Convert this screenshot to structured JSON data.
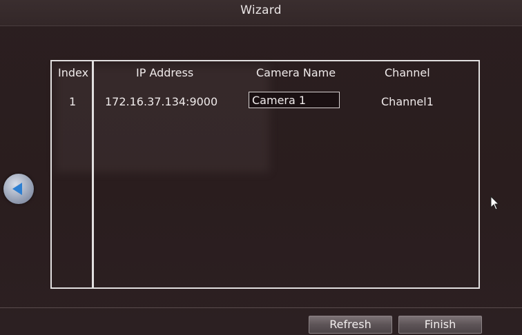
{
  "window": {
    "title": "Wizard"
  },
  "table": {
    "headers": {
      "index": "Index",
      "ip_address": "IP Address",
      "camera_name": "Camera Name",
      "channel": "Channel"
    },
    "rows": [
      {
        "index": "1",
        "ip_address": "172.16.37.134:9000",
        "camera_name": "Camera 1",
        "channel": "Channel1"
      }
    ]
  },
  "navigation": {
    "back_icon": "left-arrow-icon"
  },
  "buttons": {
    "refresh": "Refresh",
    "finish": "Finish"
  },
  "colors": {
    "background": "#2a1e1e",
    "border": "#e2e0e0",
    "accent_arrow": "#2d7fd2"
  }
}
